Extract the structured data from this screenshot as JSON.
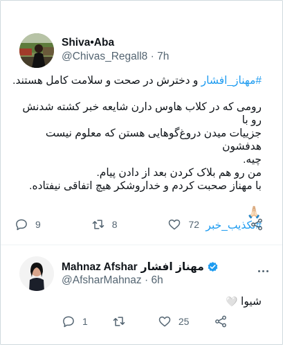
{
  "tweet1": {
    "author_name": "Shiva•Aba",
    "author_handle": "@Chivas_Regall8",
    "time": "7h",
    "text": {
      "line1_hashtag": "#مهناز_افشار",
      "line1_rest": " و دخترش در صحت و سلامت کامل هستند.",
      "para2_line1": "رومی که در کلاب هاوس دارن شایعه خبر کشته شدنش رو با",
      "para2_line2": "جزییات میدن دروغ‌گوهایی هستن که معلوم نیست هدفشون",
      "para2_line3": "چیه.",
      "para3_line1": "من رو هم بلاک کردن بعد از دادن پیام.",
      "para3_line2": "با مهناز صحبت کردم و خداروشکر هیچ اتفاقی نیفتاده.",
      "emoji": "🙏🏻",
      "hashtag2": "#تکذیب_خبر"
    },
    "actions": {
      "reply_count": "9",
      "retweet_count": "8",
      "like_count": "72"
    }
  },
  "tweet2": {
    "author_name_en": "Mahnaz Afshar",
    "author_name_fa": "مهناز افشار",
    "author_handle": "@AfsharMahnaz",
    "time": "6h",
    "text": "شیوا",
    "emoji": "🤍",
    "actions": {
      "reply_count": "1",
      "retweet_count": "",
      "like_count": "25"
    }
  },
  "icons": {
    "reply": "reply-icon",
    "retweet": "retweet-icon",
    "like": "heart-icon",
    "share": "share-icon",
    "verified": "verified-badge-icon",
    "more": "more-options-icon"
  },
  "colors": {
    "link": "#1d9bf0",
    "secondary_text": "#536471",
    "primary_text": "#0f1419",
    "verified": "#1d9bf0"
  }
}
